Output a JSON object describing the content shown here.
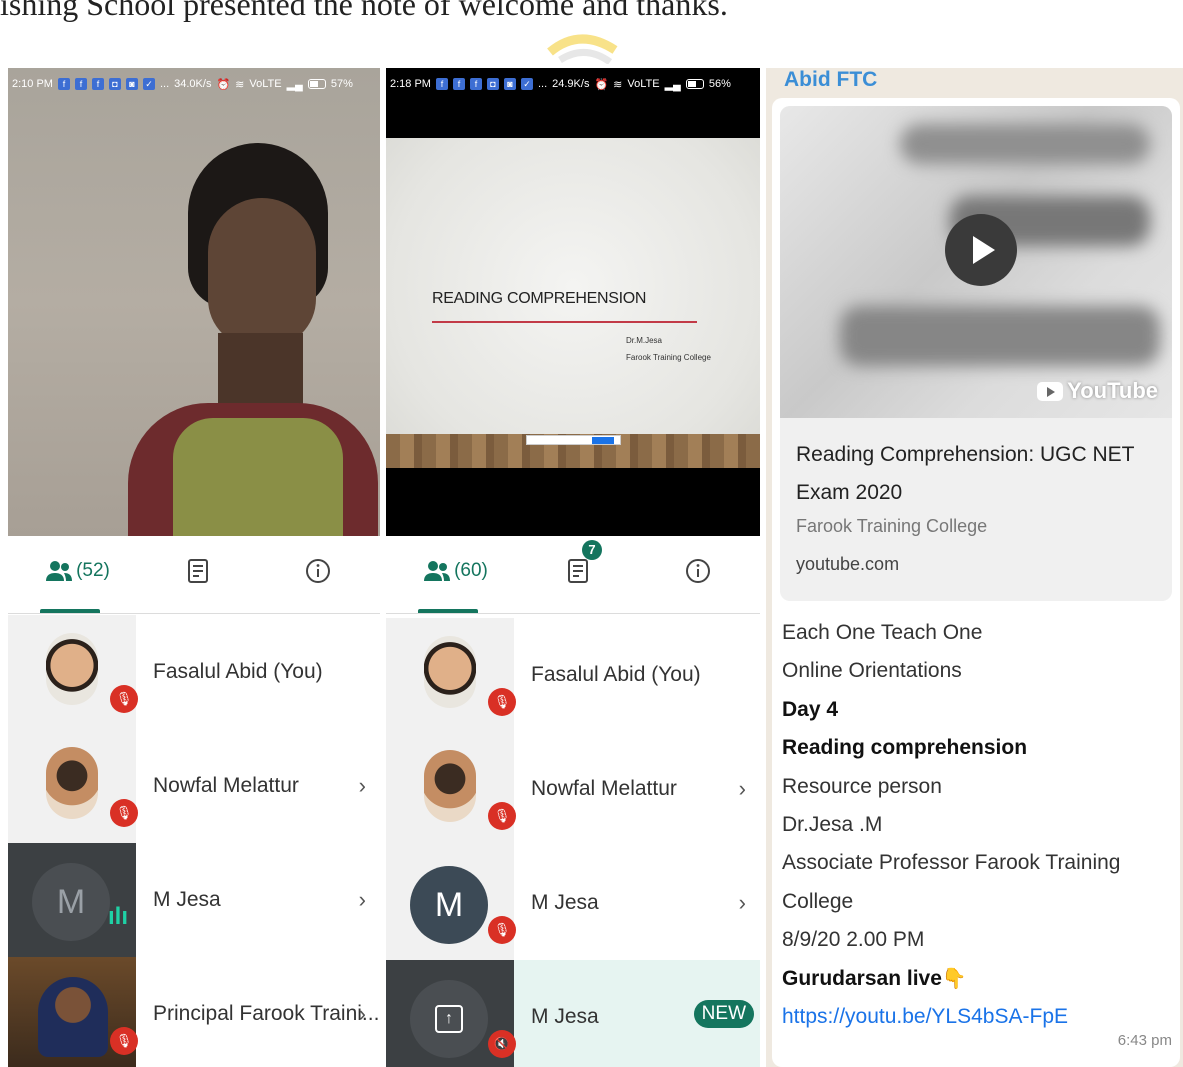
{
  "caption": "ishing School presented the note of welcome and thanks.",
  "panel1": {
    "status": {
      "time": "2:10 PM",
      "more": "...",
      "speed": "34.0K/s",
      "network": "VoLTE",
      "battery": "57%"
    },
    "people_count": "(52)",
    "participants": [
      {
        "name": "Fasalul Abid (You)",
        "chevron": ""
      },
      {
        "name": "Nowfal Melattur",
        "chevron": "›"
      },
      {
        "name": "M Jesa",
        "chevron": "›",
        "initial": "M"
      },
      {
        "name": "Principal Farook Traini...",
        "chevron": "›"
      }
    ]
  },
  "panel2": {
    "status": {
      "time": "2:18 PM",
      "more": "...",
      "speed": "24.9K/s",
      "network": "VoLTE",
      "battery": "56%"
    },
    "slide": {
      "title": "READING COMPREHENSION",
      "author": "Dr.M.Jesa",
      "college": "Farook Training College"
    },
    "people_count": "(60)",
    "chat_badge": "7",
    "participants": [
      {
        "name": "Fasalul Abid (You)",
        "chevron": ""
      },
      {
        "name": "Nowfal Melattur",
        "chevron": "›"
      },
      {
        "name": "M Jesa",
        "chevron": "›",
        "initial": "M"
      },
      {
        "name": "M Jesa",
        "badge": "NEW"
      }
    ]
  },
  "panel3": {
    "sender": "Abid FTC",
    "preview": {
      "title": "Reading Comprehension: UGC NET Exam 2020",
      "channel": "Farook Training College",
      "domain": "youtube.com",
      "brand": "YouTube"
    },
    "message": [
      "Each One Teach One",
      "Online Orientations",
      "Day 4",
      "Reading comprehension",
      "Resource person",
      "Dr.Jesa .M",
      "Associate Professor Farook Training",
      "College",
      "8/9/20  2.00 PM",
      "Gurudarsan live"
    ],
    "link": "https://youtu.be/YLS4bSA-FpE",
    "time": "6:43 pm"
  },
  "colors": {
    "accent": "#14755e",
    "mic_off": "#d93025",
    "link": "#1a73e8",
    "sender": "#3b8ed6"
  }
}
